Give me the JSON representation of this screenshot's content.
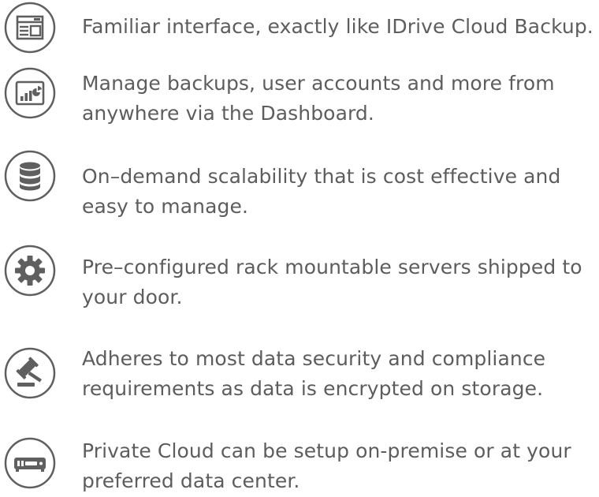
{
  "features": [
    {
      "icon": "interface-window-icon",
      "text": "Familiar interface, exactly like IDrive Cloud Backup."
    },
    {
      "icon": "dashboard-chart-icon",
      "text": "Manage backups, user accounts and more from anywhere via the Dashboard."
    },
    {
      "icon": "database-icon",
      "text": "On–demand scalability that is cost effective and easy to manage."
    },
    {
      "icon": "gear-icon",
      "text": "Pre–configured rack mountable servers shipped to your door."
    },
    {
      "icon": "gavel-icon",
      "text": "Adheres to most data security and compliance requirements as data is encrypted on storage."
    },
    {
      "icon": "server-rack-icon",
      "text": "Private Cloud can be setup on-premise or at your preferred data center."
    }
  ],
  "colors": {
    "icon_stroke": "#5f5f5f",
    "text": "#5d5d5d",
    "background": "#ffffff"
  }
}
